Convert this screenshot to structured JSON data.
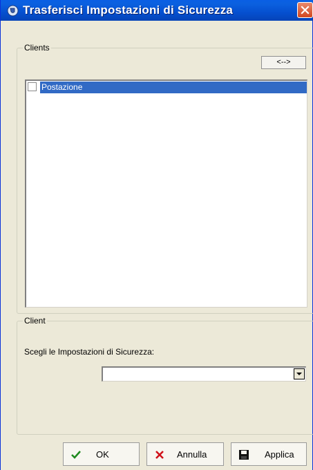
{
  "window": {
    "title": "Trasferisci Impostazioni di Sicurezza"
  },
  "clients_group": {
    "legend": "Clients",
    "swap_label": "<-->",
    "items": [
      {
        "label": "Postazione",
        "checked": false,
        "selected": true
      }
    ]
  },
  "client_group": {
    "legend": "Client",
    "prompt": "Scegli le Impostazioni di Sicurezza:",
    "select_value": ""
  },
  "buttons": {
    "ok": "OK",
    "annulla": "Annulla",
    "applica": "Applica"
  },
  "icons": {
    "title": "app-shield-icon",
    "close": "close-icon",
    "ok": "checkmark-icon",
    "annulla": "x-cancel-icon",
    "applica": "floppy-save-icon",
    "dropdown": "chevron-down-icon"
  },
  "colors": {
    "titlebar": "#0550d0",
    "selection": "#316ac5",
    "ok_icon": "#1f8a1f",
    "cancel_icon": "#d0121a"
  }
}
